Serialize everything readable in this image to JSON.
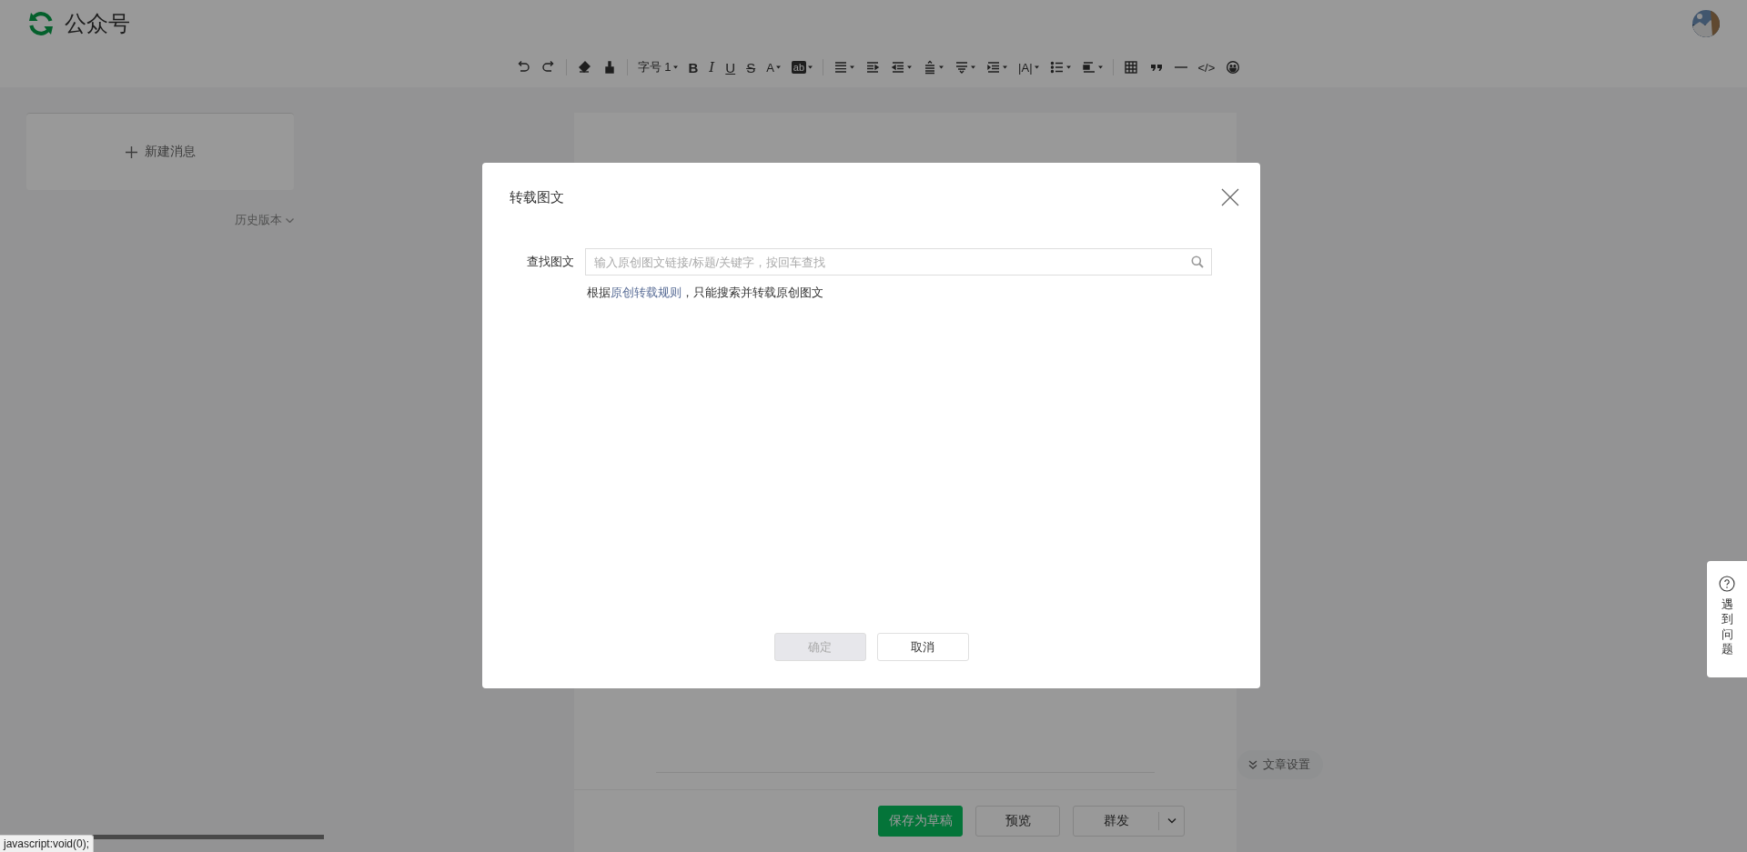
{
  "header": {
    "title": "公众号"
  },
  "toolbar": [
    {
      "kind": "undo"
    },
    {
      "kind": "redo"
    },
    {
      "kind": "separator"
    },
    {
      "kind": "eraser"
    },
    {
      "kind": "brush"
    },
    {
      "kind": "separator"
    },
    {
      "kind": "text",
      "label": "字号 1",
      "caret": true
    },
    {
      "kind": "bold",
      "label": "B",
      "caret": false
    },
    {
      "kind": "italic",
      "label": "I",
      "caret": false
    },
    {
      "kind": "underline",
      "label": "U",
      "caret": false
    },
    {
      "kind": "strike",
      "label": "S",
      "caret": false
    },
    {
      "kind": "text",
      "label": "A",
      "caret": true
    },
    {
      "kind": "highlight",
      "label": "ab",
      "caret": true
    },
    {
      "kind": "separator"
    },
    {
      "kind": "align",
      "caret": true
    },
    {
      "kind": "indent",
      "caret": false
    },
    {
      "kind": "outdent",
      "caret": true
    },
    {
      "kind": "lineheight",
      "caret": true
    },
    {
      "kind": "spacing",
      "caret": true
    },
    {
      "kind": "listindent",
      "caret": true
    },
    {
      "kind": "text",
      "label": "|A|",
      "caret": true
    },
    {
      "kind": "bullets",
      "caret": true
    },
    {
      "kind": "block",
      "caret": true
    },
    {
      "kind": "separator"
    },
    {
      "kind": "table"
    },
    {
      "kind": "quote"
    },
    {
      "kind": "rule"
    },
    {
      "kind": "text",
      "label": "</>",
      "caret": false
    },
    {
      "kind": "emoji"
    }
  ],
  "sidebar": {
    "new_message": "新建消息",
    "history": "历史版本"
  },
  "dialog": {
    "title": "转载图文",
    "field_label": "查找图文",
    "placeholder": "输入原创图文链接/标题/关键字，按回车查找",
    "hint": {
      "before": "根据",
      "link": "原创转载规则",
      "after": "，只能搜索并转载原创图文"
    },
    "buttons": [
      {
        "label": "确定",
        "kind": "primary",
        "disabled": true
      },
      {
        "label": "取消",
        "kind": "default",
        "disabled": false
      }
    ]
  },
  "bottom_bar": {
    "buttons": [
      {
        "label": "保存为草稿",
        "kind": "primary"
      },
      {
        "label": "预览",
        "kind": "default"
      },
      {
        "label": "群发",
        "kind": "split"
      }
    ]
  },
  "article_settings": "文章设置",
  "help": "遇到问题",
  "status_bar": "javascript:void(0);"
}
